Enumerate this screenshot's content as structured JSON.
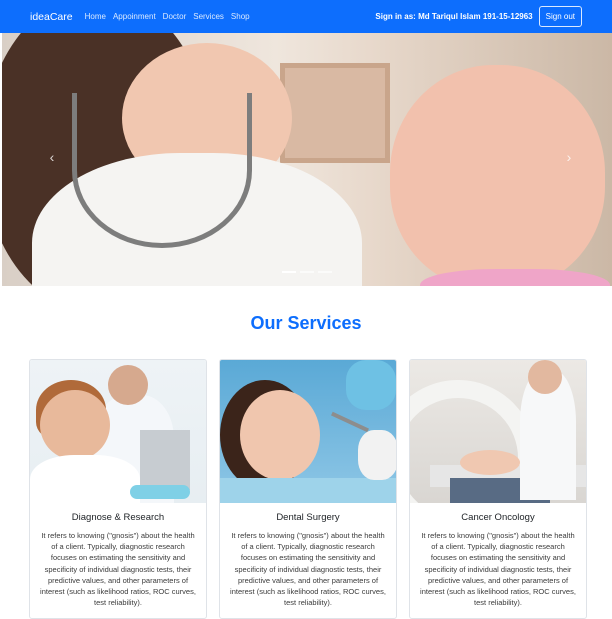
{
  "navbar": {
    "brand": "ideaCare",
    "links": [
      "Home",
      "Appoinment",
      "Doctor",
      "Services",
      "Shop"
    ],
    "user_text": "Sign in as: Md Tariqul Islam 191-15-12963",
    "signout_label": "Sign out",
    "colors": {
      "navbar_bg": "#0d6efd"
    }
  },
  "carousel": {
    "prev_icon": "chevron-left-icon",
    "next_icon": "chevron-right-icon",
    "prev_glyph": "‹",
    "next_glyph": "›",
    "slides_count": 3,
    "active_slide": 1
  },
  "services": {
    "title": "Our Services",
    "title_color": "#0d6efd",
    "cards": [
      {
        "title": "Diagnose & Research",
        "text": "It refers to knowing (\"gnosis\") about the health of a client. Typically, diagnostic research focuses on estimating the sensitivity and specificity of individual diagnostic tests, their predictive values, and other parameters of interest (such as likelihood ratios, ROC curves, test reliability)."
      },
      {
        "title": "Dental Surgery",
        "text": "It refers to knowing (\"gnosis\") about the health of a client. Typically, diagnostic research focuses on estimating the sensitivity and specificity of individual diagnostic tests, their predictive values, and other parameters of interest (such as likelihood ratios, ROC curves, test reliability)."
      },
      {
        "title": "Cancer Oncology",
        "text": "It refers to knowing (\"gnosis\") about the health of a client. Typically, diagnostic research focuses on estimating the sensitivity and specificity of individual diagnostic tests, their predictive values, and other parameters of interest (such as likelihood ratios, ROC curves, test reliability)."
      }
    ]
  }
}
